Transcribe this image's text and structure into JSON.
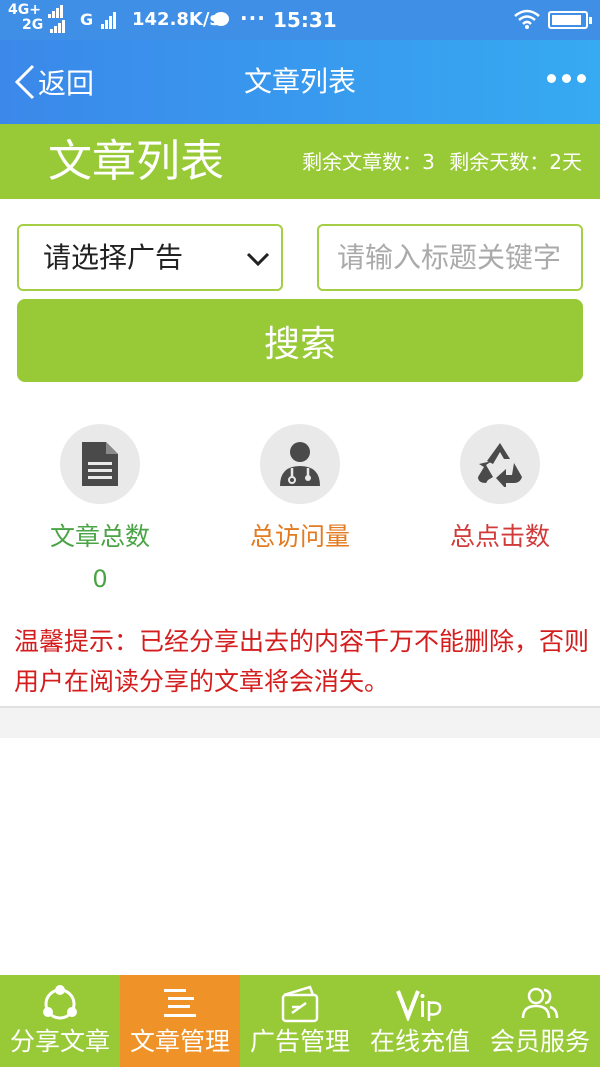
{
  "status_bar": {
    "network_top": "4G+",
    "network_bottom": "2G",
    "g_label": "G",
    "speed": "142.8K/s",
    "dots": "···",
    "time": "15:31",
    "battery_level": 0.92
  },
  "nav": {
    "back_label": "返回",
    "title": "文章列表",
    "more_icon": "more-dots-icon"
  },
  "header": {
    "title": "文章列表",
    "remaining_articles": "剩余文章数：3",
    "remaining_days": "剩余天数：2天"
  },
  "search": {
    "ad_select_value": "请选择广告",
    "keyword_placeholder": "请输入标题关键字",
    "button_label": "搜索"
  },
  "stats": [
    {
      "label": "文章总数",
      "value": "0",
      "icon": "document-icon"
    },
    {
      "label": "总访问量",
      "value": "",
      "icon": "doctor-icon"
    },
    {
      "label": "总点击数",
      "value": "",
      "icon": "recycle-icon"
    }
  ],
  "tip": "温馨提示：已经分享出去的内容千万不能删除，否则用户在阅读分享的文章将会消失。",
  "tabs": [
    {
      "label": "分享文章",
      "icon": "share-icon",
      "active": false
    },
    {
      "label": "文章管理",
      "icon": "list-icon",
      "active": true
    },
    {
      "label": "广告管理",
      "icon": "ad-card-icon",
      "active": false
    },
    {
      "label": "在线充值",
      "icon": "vip-icon",
      "active": false
    },
    {
      "label": "会员服务",
      "icon": "members-icon",
      "active": false
    }
  ],
  "colors": {
    "nav_blue": "#3b88ea",
    "green": "#98c936",
    "orange_active": "#ef9227",
    "tip_red": "#d41e1e",
    "stat_green": "#4aa445",
    "stat_orange": "#e27b22",
    "stat_red": "#d23a3a"
  }
}
